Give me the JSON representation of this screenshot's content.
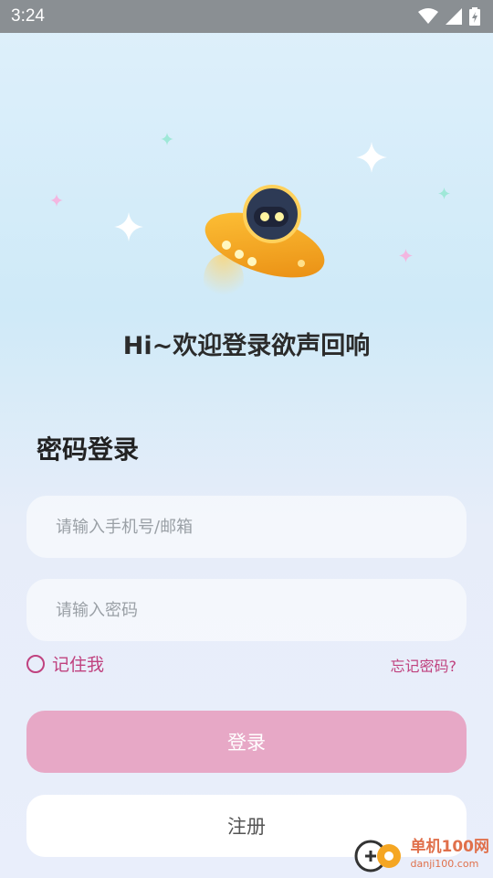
{
  "status_bar": {
    "time": "3:24",
    "icons": [
      "wifi-icon",
      "signal-icon",
      "battery-icon"
    ]
  },
  "welcome_title": "Hi~欢迎登录欲声回响",
  "section_title": "密码登录",
  "phone_field": {
    "placeholder": "请输入手机号/邮箱",
    "value": ""
  },
  "password_field": {
    "placeholder": "请输入密码",
    "value": ""
  },
  "remember_label": "记住我",
  "forgot_link": "忘记密码?",
  "login_button": "登录",
  "register_button": "注册",
  "watermark": {
    "name": "单机100网",
    "url": "danji100.com"
  },
  "colors": {
    "accent": "#c0427f",
    "login_button_bg": "#e7a8c6",
    "status_bar_bg": "#8a8f93"
  }
}
